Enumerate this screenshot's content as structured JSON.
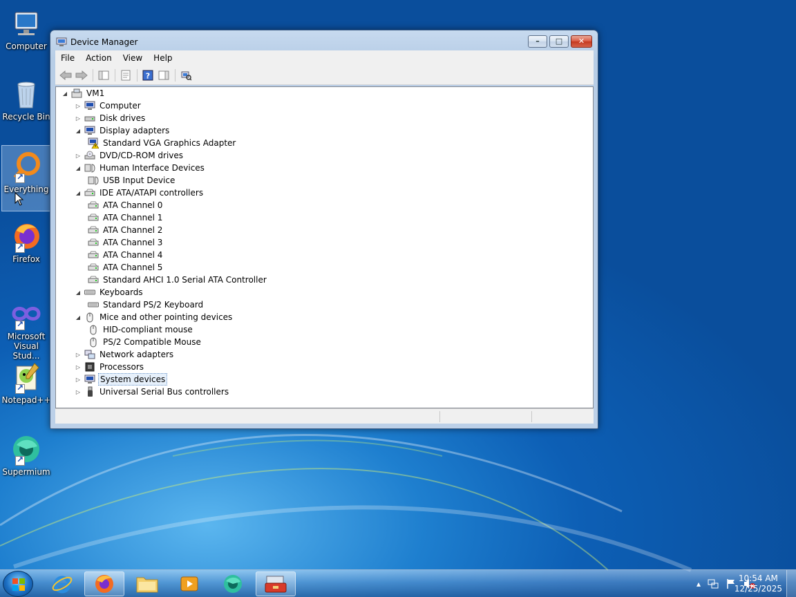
{
  "desktop": {
    "icons": [
      {
        "label": "Computer"
      },
      {
        "label": "Recycle Bin"
      },
      {
        "label": "Everything"
      },
      {
        "label": "Firefox"
      },
      {
        "label": "Microsoft Visual Stud..."
      },
      {
        "label": "Notepad++"
      },
      {
        "label": "Supermium"
      }
    ]
  },
  "window": {
    "title": "Device Manager",
    "menu": [
      "File",
      "Action",
      "View",
      "Help"
    ],
    "tree": [
      {
        "label": "VM1",
        "level": 0,
        "expanded": true,
        "icon": "computer-root-icon"
      },
      {
        "label": "Computer",
        "level": 1,
        "expanded": false,
        "icon": "computer-icon"
      },
      {
        "label": "Disk drives",
        "level": 1,
        "expanded": false,
        "icon": "disk-drive-icon"
      },
      {
        "label": "Display adapters",
        "level": 1,
        "expanded": true,
        "icon": "display-adapter-icon"
      },
      {
        "label": "Standard VGA Graphics Adapter",
        "level": 2,
        "icon": "display-adapter-warning-icon"
      },
      {
        "label": "DVD/CD-ROM drives",
        "level": 1,
        "expanded": false,
        "icon": "dvd-drive-icon"
      },
      {
        "label": "Human Interface Devices",
        "level": 1,
        "expanded": true,
        "icon": "hid-icon"
      },
      {
        "label": "USB Input Device",
        "level": 2,
        "icon": "hid-icon"
      },
      {
        "label": "IDE ATA/ATAPI controllers",
        "level": 1,
        "expanded": true,
        "icon": "ide-controller-icon"
      },
      {
        "label": "ATA Channel 0",
        "level": 2,
        "icon": "ide-controller-icon"
      },
      {
        "label": "ATA Channel 1",
        "level": 2,
        "icon": "ide-controller-icon"
      },
      {
        "label": "ATA Channel 2",
        "level": 2,
        "icon": "ide-controller-icon"
      },
      {
        "label": "ATA Channel 3",
        "level": 2,
        "icon": "ide-controller-icon"
      },
      {
        "label": "ATA Channel 4",
        "level": 2,
        "icon": "ide-controller-icon"
      },
      {
        "label": "ATA Channel 5",
        "level": 2,
        "icon": "ide-controller-icon"
      },
      {
        "label": "Standard AHCI 1.0 Serial ATA Controller",
        "level": 2,
        "icon": "ide-controller-icon"
      },
      {
        "label": "Keyboards",
        "level": 1,
        "expanded": true,
        "icon": "keyboard-icon"
      },
      {
        "label": "Standard PS/2 Keyboard",
        "level": 2,
        "icon": "keyboard-icon"
      },
      {
        "label": "Mice and other pointing devices",
        "level": 1,
        "expanded": true,
        "icon": "mouse-icon"
      },
      {
        "label": "HID-compliant mouse",
        "level": 2,
        "icon": "mouse-icon"
      },
      {
        "label": "PS/2 Compatible Mouse",
        "level": 2,
        "icon": "mouse-icon"
      },
      {
        "label": "Network adapters",
        "level": 1,
        "expanded": false,
        "icon": "network-adapter-icon"
      },
      {
        "label": "Processors",
        "level": 1,
        "expanded": false,
        "icon": "processor-icon"
      },
      {
        "label": "System devices",
        "level": 1,
        "expanded": false,
        "icon": "system-devices-icon",
        "selected": true
      },
      {
        "label": "Universal Serial Bus controllers",
        "level": 1,
        "expanded": false,
        "icon": "usb-icon"
      }
    ]
  },
  "taskbar": {
    "clock_time": "10:54 AM",
    "clock_date": "12/25/2025"
  }
}
